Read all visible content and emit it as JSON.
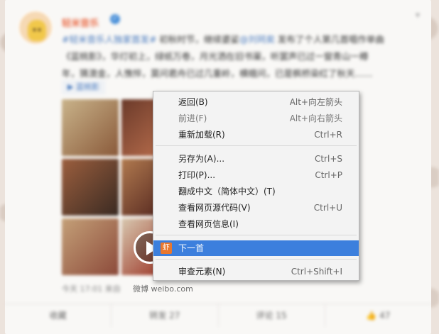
{
  "post": {
    "author": "轻米音乐",
    "text_line1_prefix": "#轻米音乐人独家首发#",
    "text_line1_rest": " 初秋时节，继续婆娑",
    "text_line1_mention": "@刘珂矣",
    "text_line1_end": " 发布了个人第几首唱作单曲",
    "text_line2": "《蓝桃影》，华灯初上，绿纸万卷，月光洒在旧书渠，听罢声已过一窗青山一樽",
    "text_line3": "年，猜澳金，人憔悴，莫问君舟已过几重岭，横蛾问，已是枫桥染红了秋天……",
    "music_link": "蓝桃影",
    "timestamp": "今天 17:01 来自",
    "source": "微博 weibo.com"
  },
  "footer": {
    "favorite": "收藏",
    "repost": "转发 27",
    "comment": "评论 15",
    "like": "47"
  },
  "context_menu": {
    "back": {
      "label": "返回(B)",
      "shortcut": "Alt+向左箭头"
    },
    "forward": {
      "label": "前进(F)",
      "shortcut": "Alt+向右箭头"
    },
    "reload": {
      "label": "重新加载(R)",
      "shortcut": "Ctrl+R"
    },
    "save_as": {
      "label": "另存为(A)...",
      "shortcut": "Ctrl+S"
    },
    "print": {
      "label": "打印(P)...",
      "shortcut": "Ctrl+P"
    },
    "translate": {
      "label": "翻成中文（简体中文）(T)",
      "shortcut": ""
    },
    "view_source": {
      "label": "查看网页源代码(V)",
      "shortcut": "Ctrl+U"
    },
    "page_info": {
      "label": "查看网页信息(I)",
      "shortcut": ""
    },
    "next_track": {
      "label": "下一首",
      "icon_text": "虾",
      "shortcut": ""
    },
    "inspect": {
      "label": "审查元素(N)",
      "shortcut": "Ctrl+Shift+I"
    }
  },
  "colors": {
    "accent": "#eb7350",
    "menu_highlight": "#3c7fdd",
    "extension_icon": "#e8772e"
  }
}
